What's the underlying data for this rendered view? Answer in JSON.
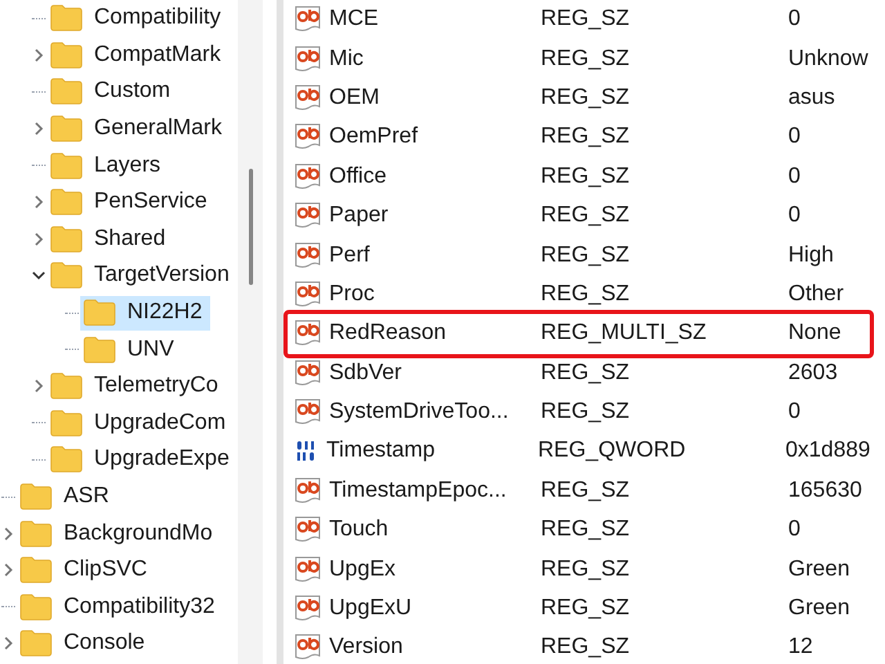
{
  "tree": {
    "partial_children": [
      {
        "label": "Compatibility",
        "has_children": false,
        "selected": false
      },
      {
        "label": "CompatMark",
        "has_children": true,
        "expanded": false,
        "selected": false
      },
      {
        "label": "Custom",
        "has_children": false,
        "selected": false
      },
      {
        "label": "GeneralMark",
        "has_children": true,
        "expanded": false,
        "selected": false
      },
      {
        "label": "Layers",
        "has_children": false,
        "selected": false
      },
      {
        "label": "PenService",
        "has_children": true,
        "expanded": false,
        "selected": false
      },
      {
        "label": "Shared",
        "has_children": true,
        "expanded": false,
        "selected": false
      },
      {
        "label": "TargetVersion",
        "has_children": true,
        "expanded": true,
        "selected": false,
        "children": [
          {
            "label": "NI22H2",
            "has_children": false,
            "selected": true
          },
          {
            "label": "UNV",
            "has_children": false,
            "selected": false
          }
        ]
      },
      {
        "label": "TelemetryCo",
        "has_children": true,
        "expanded": false,
        "selected": false
      },
      {
        "label": "UpgradeCom",
        "has_children": false,
        "selected": false
      },
      {
        "label": "UpgradeExpe",
        "has_children": false,
        "selected": false
      }
    ],
    "items": [
      {
        "label": "ASR",
        "has_children": false,
        "selected": false
      },
      {
        "label": "BackgroundMo",
        "has_children": true,
        "expanded": false,
        "selected": false
      },
      {
        "label": "ClipSVC",
        "has_children": true,
        "expanded": false,
        "selected": false
      },
      {
        "label": "Compatibility32",
        "has_children": false,
        "selected": false
      },
      {
        "label": "Console",
        "has_children": true,
        "expanded": false,
        "selected": false
      }
    ]
  },
  "values": [
    {
      "kind": "string",
      "name": "MCE",
      "type": "REG_SZ",
      "data": "0",
      "highlighted": false
    },
    {
      "kind": "string",
      "name": "Mic",
      "type": "REG_SZ",
      "data": "Unknow",
      "highlighted": false
    },
    {
      "kind": "string",
      "name": "OEM",
      "type": "REG_SZ",
      "data": "asus",
      "highlighted": false
    },
    {
      "kind": "string",
      "name": "OemPref",
      "type": "REG_SZ",
      "data": "0",
      "highlighted": false
    },
    {
      "kind": "string",
      "name": "Office",
      "type": "REG_SZ",
      "data": "0",
      "highlighted": false
    },
    {
      "kind": "string",
      "name": "Paper",
      "type": "REG_SZ",
      "data": "0",
      "highlighted": false
    },
    {
      "kind": "string",
      "name": "Perf",
      "type": "REG_SZ",
      "data": "High",
      "highlighted": false
    },
    {
      "kind": "string",
      "name": "Proc",
      "type": "REG_SZ",
      "data": "Other",
      "highlighted": false
    },
    {
      "kind": "string",
      "name": "RedReason",
      "type": "REG_MULTI_SZ",
      "data": "None",
      "highlighted": true
    },
    {
      "kind": "string",
      "name": "SdbVer",
      "type": "REG_SZ",
      "data": "2603",
      "highlighted": false
    },
    {
      "kind": "string",
      "name": "SystemDriveToo...",
      "type": "REG_SZ",
      "data": "0",
      "highlighted": false
    },
    {
      "kind": "binary",
      "name": "Timestamp",
      "type": "REG_QWORD",
      "data": "0x1d889",
      "highlighted": false
    },
    {
      "kind": "string",
      "name": "TimestampEpoc...",
      "type": "REG_SZ",
      "data": "165630",
      "highlighted": false
    },
    {
      "kind": "string",
      "name": "Touch",
      "type": "REG_SZ",
      "data": "0",
      "highlighted": false
    },
    {
      "kind": "string",
      "name": "UpgEx",
      "type": "REG_SZ",
      "data": "Green",
      "highlighted": false
    },
    {
      "kind": "string",
      "name": "UpgExU",
      "type": "REG_SZ",
      "data": "Green",
      "highlighted": false
    },
    {
      "kind": "string",
      "name": "Version",
      "type": "REG_SZ",
      "data": "12",
      "highlighted": false
    }
  ]
}
